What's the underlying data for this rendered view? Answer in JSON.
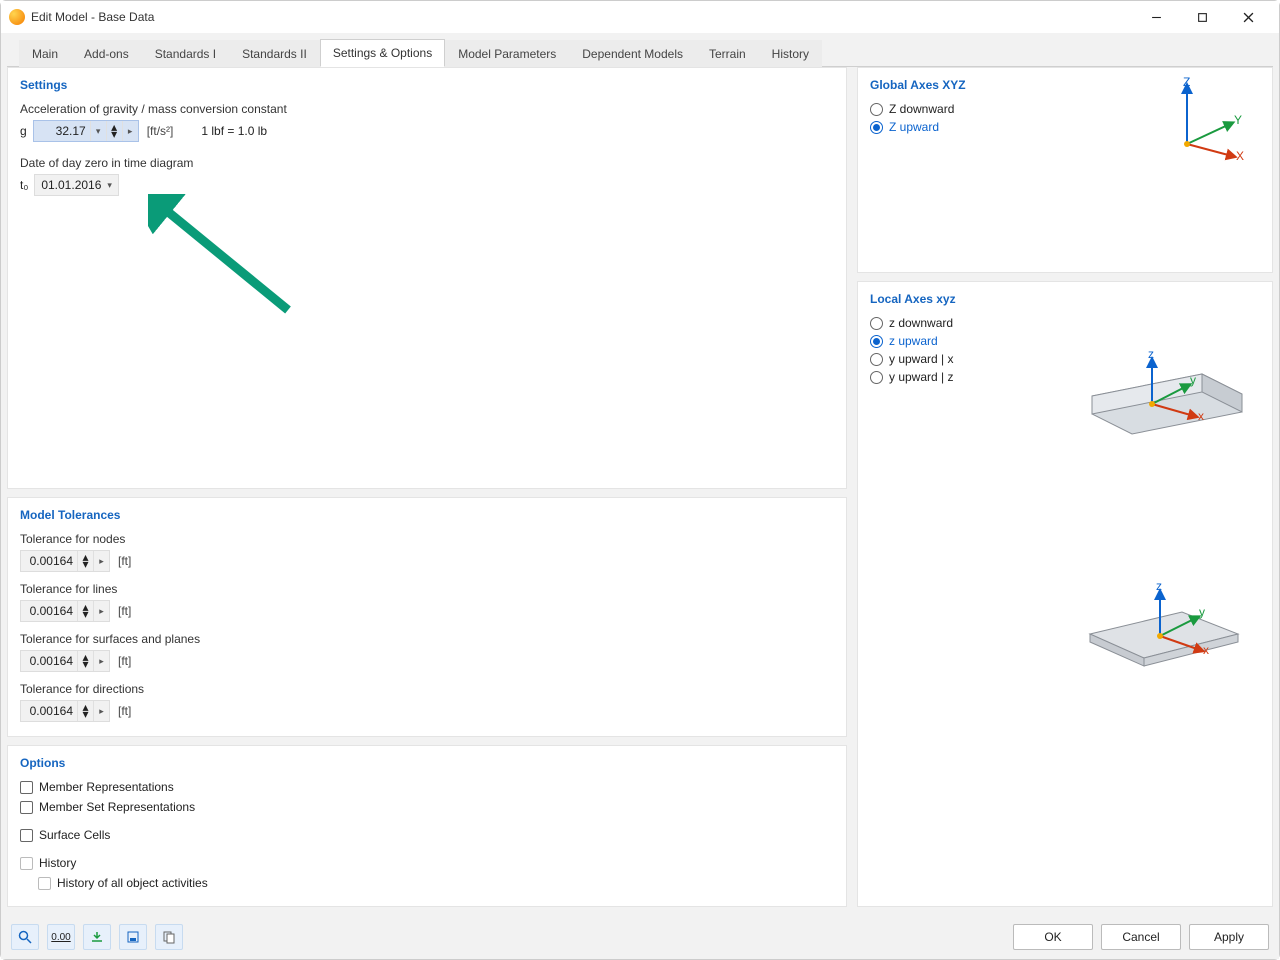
{
  "window": {
    "title": "Edit Model - Base Data"
  },
  "tabs": [
    "Main",
    "Add-ons",
    "Standards I",
    "Standards II",
    "Settings & Options",
    "Model Parameters",
    "Dependent Models",
    "Terrain",
    "History"
  ],
  "active_tab": "Settings & Options",
  "settings": {
    "heading": "Settings",
    "accel_label": "Acceleration of gravity / mass conversion constant",
    "g_sym": "g",
    "g_val": "32.17",
    "g_unit": "[ft/s²]",
    "lbf_note": "1 lbf = 1.0 lb",
    "date_label": "Date of day zero in time diagram",
    "t0_sym": "t₀",
    "t0_val": "01.01.2016"
  },
  "tol": {
    "heading": "Model Tolerances",
    "nodes": {
      "label": "Tolerance for nodes",
      "val": "0.00164",
      "unit": "[ft]"
    },
    "lines": {
      "label": "Tolerance for lines",
      "val": "0.00164",
      "unit": "[ft]"
    },
    "surf": {
      "label": "Tolerance for surfaces and planes",
      "val": "0.00164",
      "unit": "[ft]"
    },
    "dir": {
      "label": "Tolerance for directions",
      "val": "0.00164",
      "unit": "[ft]"
    }
  },
  "options": {
    "heading": "Options",
    "member_rep": "Member Representations",
    "memberset_rep": "Member Set Representations",
    "surface_cells": "Surface Cells",
    "history": "History",
    "history_all": "History of all object activities"
  },
  "global": {
    "heading": "Global Axes XYZ",
    "zdown": "Z downward",
    "zup": "Z upward"
  },
  "local": {
    "heading": "Local Axes xyz",
    "zdown": "z downward",
    "zup": "z upward",
    "yupx": "y upward | x",
    "yupz": "y upward | z"
  },
  "footer": {
    "ok": "OK",
    "cancel": "Cancel",
    "apply": "Apply"
  }
}
